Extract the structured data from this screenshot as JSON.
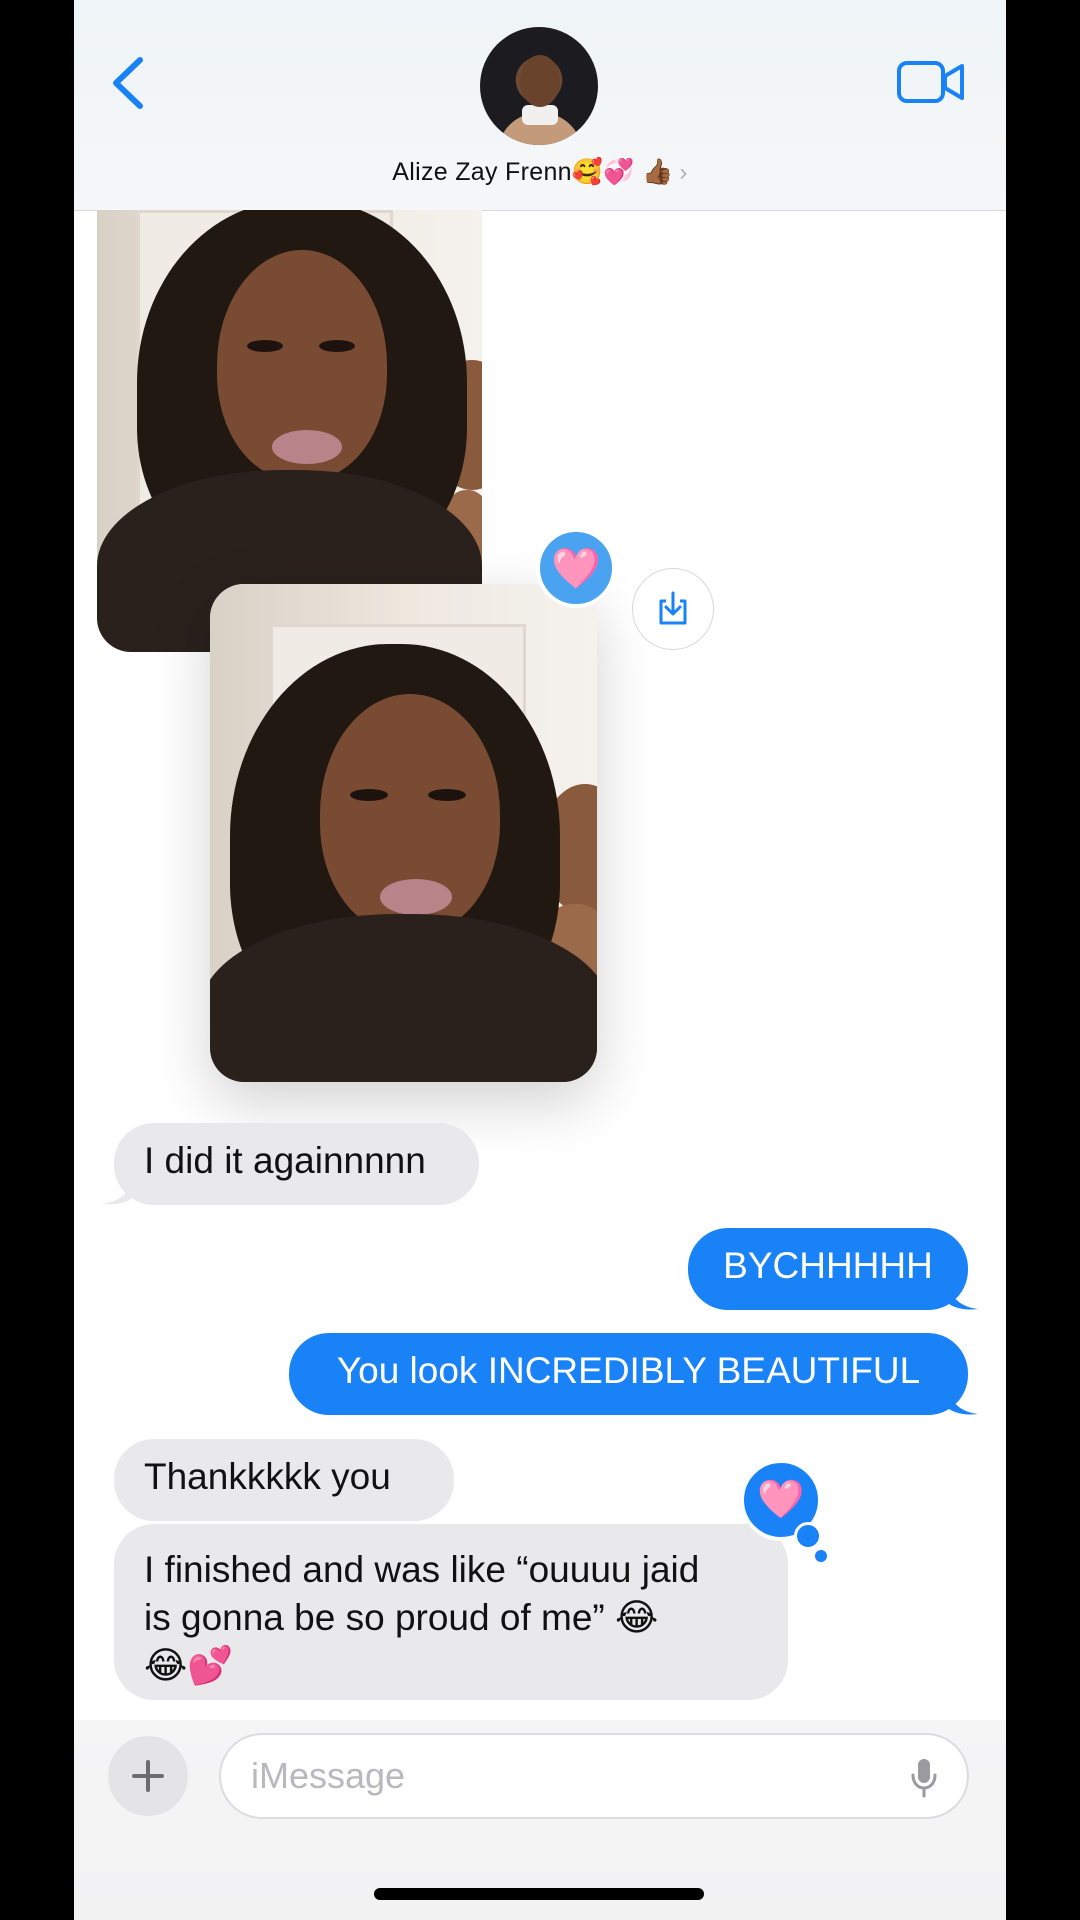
{
  "header": {
    "contact_name": "Alize Zay Frenn🥰💞 👍🏾",
    "chevron": "›",
    "icons": [
      "back-chevron-icon",
      "video-camera-icon",
      "avatar"
    ]
  },
  "reactions": {
    "photo_tapback": "🩷",
    "message_tapback": "🩷"
  },
  "messages": [
    {
      "dir": "in",
      "text": "I did it againnnnn"
    },
    {
      "dir": "out",
      "text": "BYCHHHHH"
    },
    {
      "dir": "out",
      "text": "You look INCREDIBLY BEAUTIFUL"
    },
    {
      "dir": "in",
      "text": "Thankkkkk you"
    },
    {
      "dir": "in",
      "text": "I finished and was like “ouuuu jaid\nis gonna be so proud of me” 😂\n😂💕"
    }
  ],
  "composer": {
    "placeholder": "iMessage",
    "plus": "+"
  },
  "colors": {
    "outgoing": "#1a82f7",
    "incoming": "#e9e9eb",
    "accent": "#1a82f7"
  }
}
